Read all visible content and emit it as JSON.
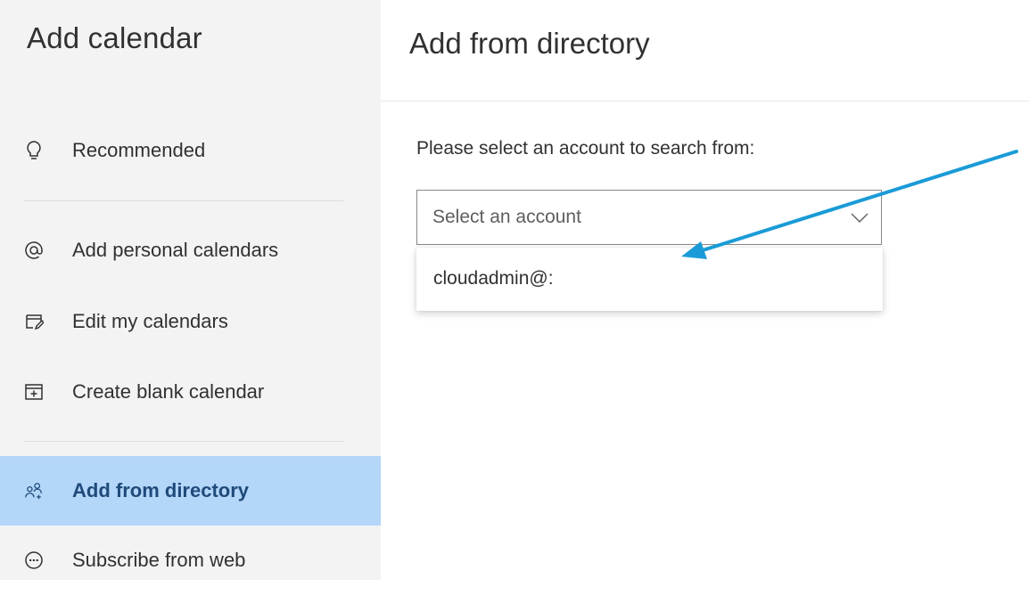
{
  "sidebar": {
    "title": "Add calendar",
    "items": [
      {
        "label": "Recommended",
        "icon": "lightbulb-icon"
      },
      {
        "label": "Add personal calendars",
        "icon": "at-sign-icon"
      },
      {
        "label": "Edit my calendars",
        "icon": "edit-calendar-icon"
      },
      {
        "label": "Create blank calendar",
        "icon": "calendar-add-icon"
      },
      {
        "label": "Add from directory",
        "icon": "people-directory-icon",
        "active": true
      },
      {
        "label": "Subscribe from web",
        "icon": "subscribe-web-icon"
      }
    ]
  },
  "main": {
    "title": "Add from directory",
    "prompt": "Please select an account to search from:",
    "select": {
      "placeholder": "Select an account",
      "options": [
        "cloudadmin@:"
      ]
    }
  },
  "colors": {
    "sidebar_bg": "#f3f3f3",
    "active_bg": "#b3d6f9",
    "arrow": "#1a9bd7"
  }
}
